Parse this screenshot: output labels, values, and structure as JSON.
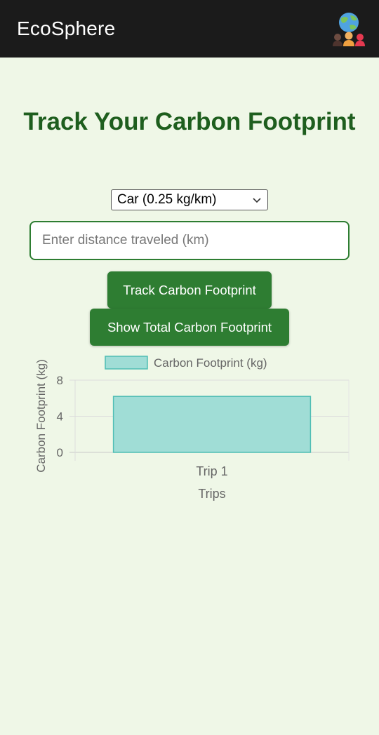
{
  "header": {
    "app_title": "EcoSphere",
    "avatar_icon": "globe-people-icon"
  },
  "main": {
    "title": "Track Your Carbon Footprint",
    "transport_select": {
      "selected": "Car (0.25 kg/km)"
    },
    "distance_input": {
      "placeholder": "Enter distance traveled (km)",
      "value": ""
    },
    "buttons": {
      "track": "Track Carbon Footprint",
      "show_total": "Show Total Carbon Footprint"
    }
  },
  "colors": {
    "header_bg": "#1b1b1b",
    "page_bg": "#eff7e7",
    "accent": "#2e7d32",
    "title": "#1e5e1e",
    "bar_fill": "#a0ddd6",
    "bar_stroke": "#4fbdb4"
  },
  "chart_data": {
    "type": "bar",
    "categories": [
      "Trip 1"
    ],
    "series": [
      {
        "name": "Carbon Footprint (kg)",
        "values": [
          6.2
        ]
      }
    ],
    "xlabel": "Trips",
    "ylabel": "Carbon Footprint (kg)",
    "ylim": [
      0,
      8
    ],
    "yticks": [
      0,
      4,
      8
    ],
    "grid": true,
    "legend": "top-center"
  }
}
